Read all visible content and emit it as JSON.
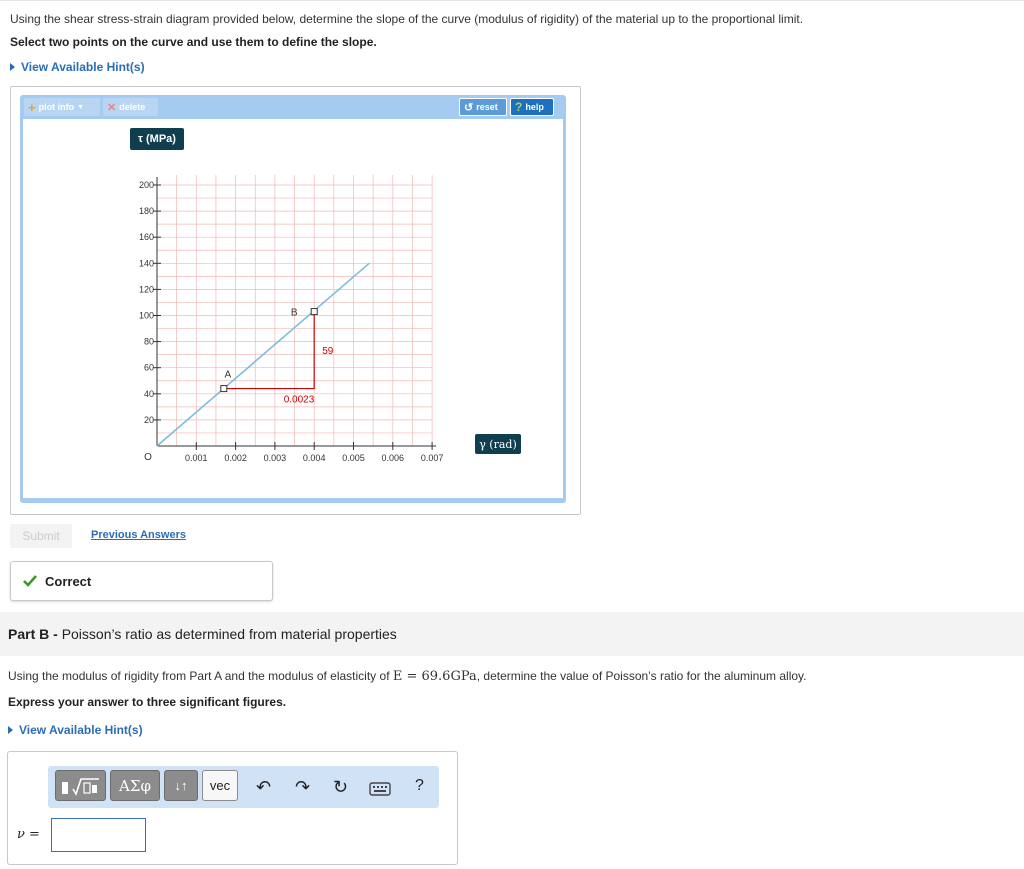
{
  "partA": {
    "question": "Using the shear stress-strain diagram provided below, determine the slope of the curve (modulus of rigidity) of the material up to the proportional limit.",
    "instruction": "Select two points on the curve and use them to define the slope.",
    "hint_label": "View Available Hint(s)"
  },
  "plot_tool": {
    "plot_info_label": "plot info",
    "delete_label": "delete",
    "reset_label": "reset",
    "help_label": "help",
    "y_axis_label": "τ (MPa)",
    "x_axis_label": "γ (rad)",
    "origin_label": "O"
  },
  "chart_data": {
    "type": "line",
    "xlabel": "γ (rad)",
    "ylabel": "τ (MPa)",
    "xlim": [
      0,
      0.007
    ],
    "ylim": [
      0,
      200
    ],
    "x_ticks": [
      "0.001",
      "0.002",
      "0.003",
      "0.004",
      "0.005",
      "0.006",
      "0.007"
    ],
    "y_ticks": [
      "20",
      "40",
      "60",
      "80",
      "100",
      "120",
      "140",
      "160",
      "180",
      "200"
    ],
    "grid": true,
    "series": [
      {
        "x": [
          0,
          0.0054
        ],
        "y": [
          0,
          140
        ]
      }
    ],
    "points": [
      {
        "label": "A",
        "x": 0.0017,
        "y": 44
      },
      {
        "label": "B",
        "x": 0.004,
        "y": 103
      }
    ],
    "annotations": [
      {
        "text": "59"
      },
      {
        "text": "0.0023"
      }
    ],
    "colors": {
      "line": "#7bbde0",
      "marker": "#cc0000",
      "grid": "#f2b8b8"
    }
  },
  "actions": {
    "submit_label": "Submit",
    "previous_answers_label": "Previous Answers"
  },
  "feedback": {
    "status": "Correct",
    "status_color": "#3a9a2a"
  },
  "partB": {
    "label": "Part B",
    "separator": " - ",
    "title": "Poisson’s ratio as determined from material properties",
    "question_pre": "Using the modulus of rigidity from Part A and the modulus of elasticity of ",
    "question_math": "E = 69.6GPa",
    "question_post": ", determine the value of Poisson’s ratio for the aluminum alloy.",
    "instruction": "Express your answer to three significant figures.",
    "hint_label": "View Available Hint(s)"
  },
  "answer": {
    "variable_label": "ν =",
    "value": "",
    "toolbar": {
      "templates_icon": "templates-icon",
      "greek_label": "ΑΣφ",
      "arrows_label": "↓↑",
      "vec_label": "vec",
      "undo_icon": "undo-icon",
      "redo_icon": "redo-icon",
      "reset_icon": "reset-icon",
      "keyboard_icon": "keyboard-icon",
      "help_label": "?"
    }
  }
}
